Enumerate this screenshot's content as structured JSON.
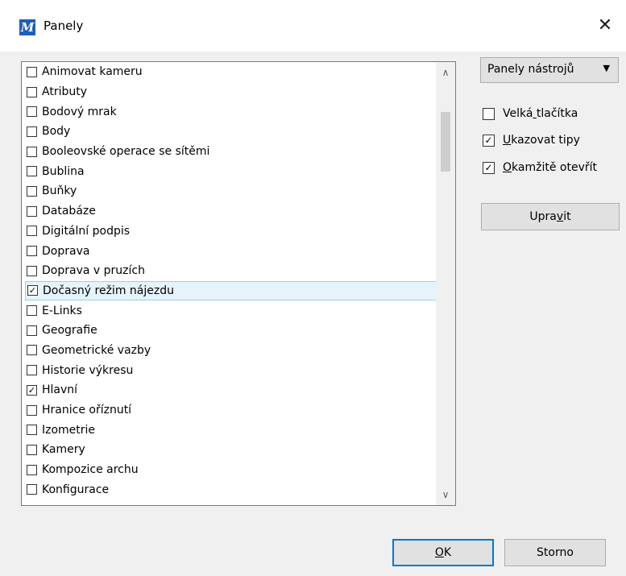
{
  "window": {
    "title": "Panely",
    "close_glyph": "✕",
    "app_icon_glyph": "M"
  },
  "list": {
    "items": [
      {
        "label": "Animovat kameru",
        "checked": false
      },
      {
        "label": "Atributy",
        "checked": false
      },
      {
        "label": "Bodový mrak",
        "checked": false
      },
      {
        "label": "Body",
        "checked": false
      },
      {
        "label": "Booleovské operace se sítěmi",
        "checked": false
      },
      {
        "label": "Bublina",
        "checked": false
      },
      {
        "label": "Buňky",
        "checked": false
      },
      {
        "label": "Databáze",
        "checked": false
      },
      {
        "label": "Digitální podpis",
        "checked": false
      },
      {
        "label": "Doprava",
        "checked": false
      },
      {
        "label": "Doprava v pruzích",
        "checked": false
      },
      {
        "label": "Dočasný režim nájezdu",
        "checked": true,
        "selected": true
      },
      {
        "label": "E-Links",
        "checked": false
      },
      {
        "label": "Geografie",
        "checked": false
      },
      {
        "label": "Geometrické vazby",
        "checked": false
      },
      {
        "label": "Historie výkresu",
        "checked": false
      },
      {
        "label": "Hlavní",
        "checked": true
      },
      {
        "label": "Hranice oříznutí",
        "checked": false
      },
      {
        "label": "Izometrie",
        "checked": false
      },
      {
        "label": "Kamery",
        "checked": false
      },
      {
        "label": "Kompozice archu",
        "checked": false
      },
      {
        "label": "Konfigurace",
        "checked": false
      }
    ],
    "scroll_up_glyph": "∧",
    "scroll_down_glyph": "∨"
  },
  "side": {
    "dropdown_value": "Panely nástrojů",
    "dropdown_arrow": "▼",
    "options": [
      {
        "label": "Velká tlačítka",
        "checked": false
      },
      {
        "label": "Ukazovat tipy",
        "checked": true
      },
      {
        "label": "Okamžitě otevřít",
        "checked": true
      }
    ],
    "edit_button": "Upravit"
  },
  "footer": {
    "ok": "OK",
    "cancel": "Storno"
  },
  "check_glyph": "✓"
}
